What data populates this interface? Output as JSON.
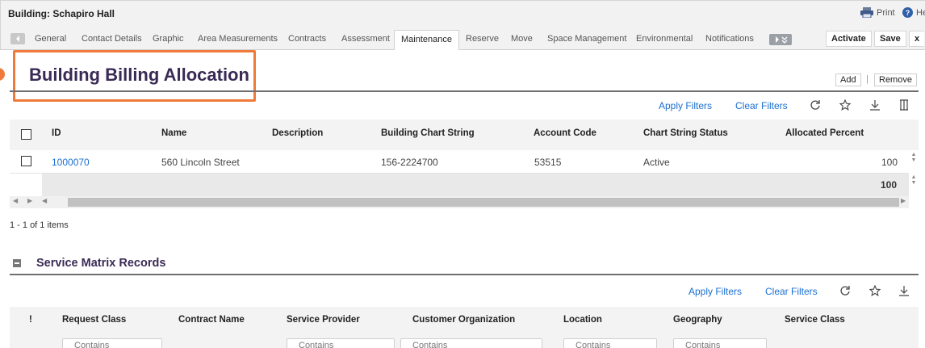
{
  "window": {
    "title": "Building: Schapiro Hall",
    "print_label": "Print",
    "help_label": "Help"
  },
  "tabs": [
    {
      "label": "General"
    },
    {
      "label": "Contact Details"
    },
    {
      "label": "Graphic"
    },
    {
      "label": "Area Measurements"
    },
    {
      "label": "Contracts"
    },
    {
      "label": "Assessment"
    },
    {
      "label": "Maintenance",
      "active": true
    },
    {
      "label": "Reserve"
    },
    {
      "label": "Move"
    },
    {
      "label": "Space Management"
    },
    {
      "label": "Environmental"
    },
    {
      "label": "Notifications"
    }
  ],
  "toolbar": {
    "activate_label": "Activate",
    "save_label": "Save",
    "close_label": "x"
  },
  "billing": {
    "title": "Building Billing Allocation",
    "add_label": "Add",
    "remove_label": "Remove",
    "apply_filters": "Apply Filters",
    "clear_filters": "Clear Filters",
    "columns": {
      "id": "ID",
      "name": "Name",
      "description": "Description",
      "chart_string": "Building Chart String",
      "account_code": "Account Code",
      "status": "Chart String Status",
      "allocated": "Allocated Percent"
    },
    "rows": [
      {
        "id": "1000070",
        "name": "560 Lincoln Street",
        "description": "",
        "chart_string": "156-2224700",
        "account_code": "53515",
        "status": "Active",
        "allocated": "100"
      }
    ],
    "total_allocated": "100",
    "pager": "1 - 1 of 1 items"
  },
  "service_matrix": {
    "title": "Service Matrix Records",
    "apply_filters": "Apply Filters",
    "clear_filters": "Clear Filters",
    "columns": {
      "flag": "!",
      "request_class": "Request Class",
      "contract_name": "Contract Name",
      "service_provider": "Service Provider",
      "customer_org": "Customer Organization",
      "location": "Location",
      "geography": "Geography",
      "service_class": "Service Class"
    },
    "filter_placeholder": "Contains"
  },
  "colors": {
    "accent_link": "#1a6fd0",
    "highlight": "#f07a3a",
    "heading": "#3a2a55"
  }
}
